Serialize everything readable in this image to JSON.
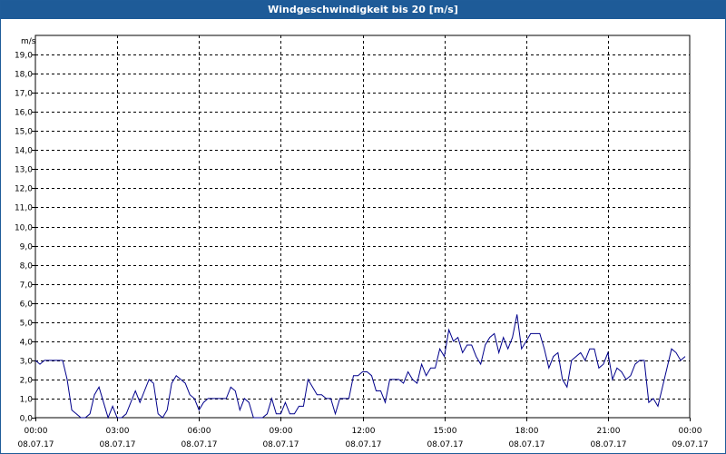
{
  "window": {
    "title": "Windgeschwindigkeit bis 20 [m/s]"
  },
  "colors": {
    "titlebar": "#1e5b98",
    "line": "#00008b",
    "grid": "#000000"
  },
  "chart_data": {
    "type": "line",
    "title": "Windgeschwindigkeit bis 20 [m/s]",
    "ylabel": "m/s",
    "xlabel": "",
    "ylim": [
      0,
      20
    ],
    "yticks": [
      "0,0",
      "1,0",
      "2,0",
      "3,0",
      "4,0",
      "5,0",
      "6,0",
      "7,0",
      "8,0",
      "9,0",
      "10,0",
      "11,0",
      "12,0",
      "13,0",
      "14,0",
      "15,0",
      "16,0",
      "17,0",
      "18,0",
      "19,0"
    ],
    "xlim": [
      "08.07.17 00:00",
      "09.07.17 00:00"
    ],
    "xticks": [
      {
        "time": "00:00",
        "date": "08.07.17"
      },
      {
        "time": "03:00",
        "date": "08.07.17"
      },
      {
        "time": "06:00",
        "date": "08.07.17"
      },
      {
        "time": "09:00",
        "date": "08.07.17"
      },
      {
        "time": "12:00",
        "date": "08.07.17"
      },
      {
        "time": "15:00",
        "date": "08.07.17"
      },
      {
        "time": "18:00",
        "date": "08.07.17"
      },
      {
        "time": "21:00",
        "date": "08.07.17"
      },
      {
        "time": "00:00",
        "date": "09.07.17"
      }
    ],
    "grid": true,
    "series": [
      {
        "x": [
          "00:00",
          "00:10",
          "00:20",
          "00:30",
          "00:40",
          "00:50",
          "01:00",
          "01:10",
          "01:20",
          "01:30",
          "01:40",
          "01:50",
          "02:00",
          "02:10",
          "02:20",
          "02:30",
          "02:40",
          "02:50",
          "03:00",
          "03:10",
          "03:20",
          "03:30",
          "03:40",
          "03:50",
          "04:00",
          "04:10",
          "04:20",
          "04:30",
          "04:40",
          "04:50",
          "05:00",
          "05:10",
          "05:20",
          "05:30",
          "05:40",
          "05:50",
          "06:00",
          "06:10",
          "06:20",
          "06:30",
          "06:40",
          "06:50",
          "07:00",
          "07:10",
          "07:20",
          "07:30",
          "07:40",
          "07:50",
          "08:00",
          "08:10",
          "08:20",
          "08:30",
          "08:40",
          "08:50",
          "09:00",
          "09:10",
          "09:20",
          "09:30",
          "09:40",
          "09:50",
          "10:00",
          "10:10",
          "10:20",
          "10:30",
          "10:40",
          "10:50",
          "11:00",
          "11:10",
          "11:20",
          "11:30",
          "11:40",
          "11:50",
          "12:00",
          "12:10",
          "12:20",
          "12:30",
          "12:40",
          "12:50",
          "13:00",
          "13:10",
          "13:20",
          "13:30",
          "13:40",
          "13:50",
          "14:00",
          "14:10",
          "14:20",
          "14:30",
          "14:40",
          "14:50",
          "15:00",
          "15:10",
          "15:20",
          "15:30",
          "15:40",
          "15:50",
          "16:00",
          "16:10",
          "16:20",
          "16:30",
          "16:40",
          "16:50",
          "17:00",
          "17:10",
          "17:20",
          "17:30",
          "17:40",
          "17:50",
          "18:00",
          "18:10",
          "18:20",
          "18:30",
          "18:40",
          "18:50",
          "19:00",
          "19:10",
          "19:20",
          "19:30",
          "19:40",
          "19:50",
          "20:00",
          "20:10",
          "20:20",
          "20:30",
          "20:40",
          "20:50",
          "21:00",
          "21:10",
          "21:20",
          "21:30",
          "21:40",
          "21:50",
          "22:00",
          "22:10",
          "22:20",
          "22:30",
          "22:40",
          "22:50",
          "23:00",
          "23:10",
          "23:20",
          "23:30",
          "23:40",
          "23:50"
        ],
        "values": [
          3.0,
          2.8,
          3.0,
          3.0,
          3.0,
          3.0,
          3.0,
          2.0,
          0.4,
          0.2,
          0.0,
          0.0,
          0.2,
          1.2,
          1.6,
          0.8,
          0.0,
          0.6,
          0.0,
          0.0,
          0.2,
          0.8,
          1.4,
          0.8,
          1.4,
          2.0,
          1.8,
          0.2,
          0.0,
          0.4,
          1.8,
          2.2,
          2.0,
          1.8,
          1.2,
          1.0,
          0.4,
          0.8,
          1.0,
          1.0,
          1.0,
          1.0,
          1.0,
          1.6,
          1.4,
          0.4,
          1.0,
          0.8,
          0.0,
          0.0,
          0.0,
          0.2,
          1.0,
          0.2,
          0.2,
          0.8,
          0.2,
          0.2,
          0.6,
          0.6,
          2.0,
          1.6,
          1.2,
          1.2,
          1.0,
          1.0,
          0.2,
          1.0,
          1.0,
          1.0,
          2.2,
          2.2,
          2.4,
          2.4,
          2.2,
          1.4,
          1.4,
          0.8,
          2.0,
          2.0,
          2.0,
          1.8,
          2.4,
          2.0,
          1.8,
          2.8,
          2.2,
          2.6,
          2.6,
          3.6,
          3.2,
          4.6,
          4.0,
          4.2,
          3.4,
          3.8,
          3.8,
          3.2,
          2.8,
          3.8,
          4.2,
          4.4,
          3.4,
          4.2,
          3.6,
          4.2,
          5.4,
          3.6,
          4.0,
          4.4,
          4.4,
          4.4,
          3.6,
          2.6,
          3.2,
          3.4,
          2.0,
          1.6,
          3.0,
          3.2,
          3.4,
          3.0,
          3.6,
          3.6,
          2.6,
          2.8,
          3.4,
          2.0,
          2.6,
          2.4,
          2.0,
          2.2,
          2.8,
          3.0,
          3.0,
          0.8,
          1.0,
          0.6,
          1.6,
          2.6,
          3.6,
          3.4,
          3.0,
          3.2
        ]
      }
    ]
  }
}
